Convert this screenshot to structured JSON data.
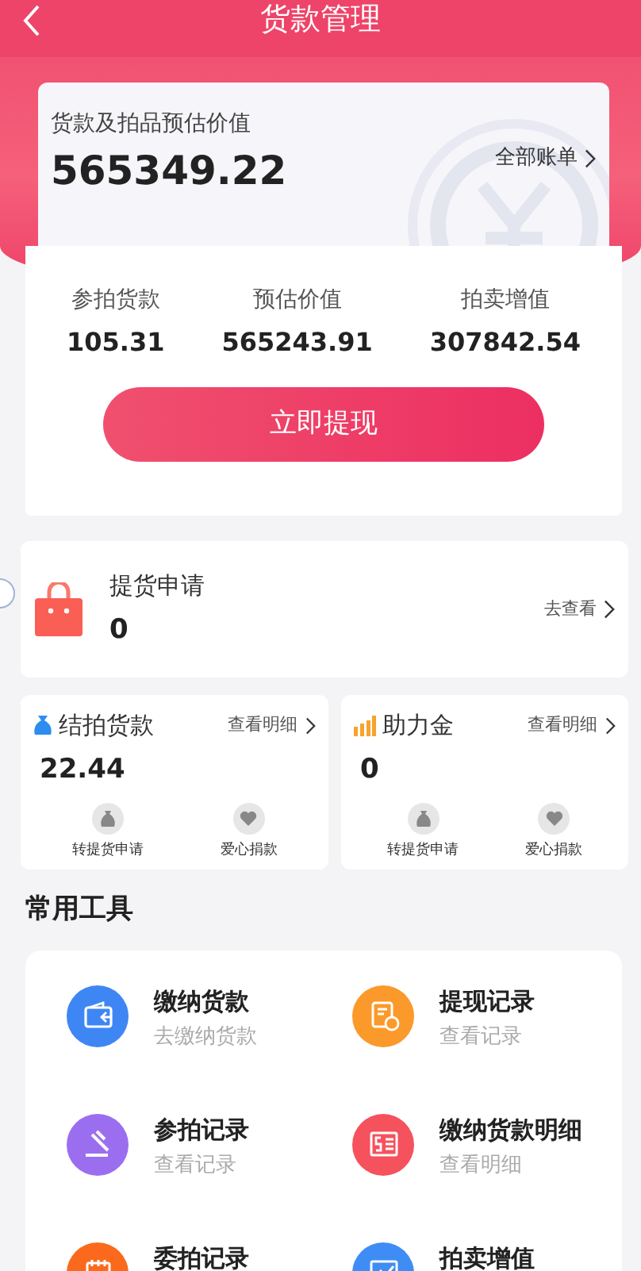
{
  "header": {
    "title": "货款管理"
  },
  "summary": {
    "label": "货款及拍品预估价值",
    "amount": "565349.22",
    "link": "全部账单"
  },
  "stats": [
    {
      "label": "参拍货款",
      "value": "105.31"
    },
    {
      "label": "预估价值",
      "value": "565243.91"
    },
    {
      "label": "拍卖增值",
      "value": "307842.54"
    }
  ],
  "withdraw_button": "立即提现",
  "delivery": {
    "title": "提货申请",
    "value": "0",
    "link": "去查看"
  },
  "funds": [
    {
      "kind": "bag",
      "title": "结拍货款",
      "link": "查看明细",
      "value": "22.44",
      "actions": [
        {
          "kind": "moneybag",
          "label": "转提货申请"
        },
        {
          "kind": "heart",
          "label": "爱心捐款"
        }
      ]
    },
    {
      "kind": "bars",
      "title": "助力金",
      "link": "查看明细",
      "value": "0",
      "actions": [
        {
          "kind": "moneybag",
          "label": "转提货申请"
        },
        {
          "kind": "heart",
          "label": "爱心捐款"
        }
      ]
    }
  ],
  "tools": {
    "title": "常用工具",
    "items": [
      {
        "kind": "wallet",
        "color": "#3f86f5",
        "title": "缴纳货款",
        "subtitle": "去缴纳货款"
      },
      {
        "kind": "receipt",
        "color": "#fb9a2a",
        "title": "提现记录",
        "subtitle": "查看记录"
      },
      {
        "kind": "gavel",
        "color": "#9b6ef0",
        "title": "参拍记录",
        "subtitle": "查看记录"
      },
      {
        "kind": "bill",
        "color": "#f5525e",
        "title": "缴纳货款明细",
        "subtitle": "查看明细"
      },
      {
        "kind": "calendar",
        "color": "#fb6a1c",
        "title": "委拍记录"
      },
      {
        "kind": "chart",
        "color": "#3f8cf5",
        "title": "拍卖增值"
      }
    ]
  }
}
